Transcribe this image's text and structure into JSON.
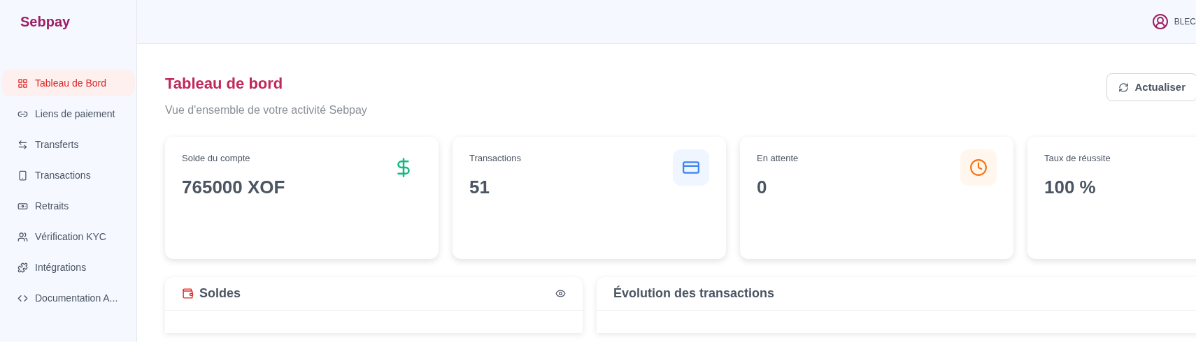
{
  "brand": "Sebpay",
  "sidebar": {
    "items": [
      {
        "label": "Tableau de Bord",
        "selected": true
      },
      {
        "label": "Liens de paiement",
        "selected": false
      },
      {
        "label": "Transferts",
        "selected": false
      },
      {
        "label": "Transactions",
        "selected": false
      },
      {
        "label": "Retraits",
        "selected": false
      },
      {
        "label": "Vérification KYC",
        "selected": false
      },
      {
        "label": "Intégrations",
        "selected": false
      },
      {
        "label": "Documentation A...",
        "selected": false
      }
    ]
  },
  "header": {
    "user": "BLEC"
  },
  "page": {
    "title": "Tableau de bord",
    "subtitle": "Vue d'ensemble de votre activité Sebpay",
    "refresh_button": "Actualiser"
  },
  "stats": [
    {
      "label": "Solde du compte",
      "value": "765000 XOF"
    },
    {
      "label": "Transactions",
      "value": "51"
    },
    {
      "label": "En attente",
      "value": "0"
    },
    {
      "label": "Taux de réussite",
      "value": "100 %"
    }
  ],
  "panels": [
    {
      "title": "Soldes",
      "kind": "balances"
    },
    {
      "title": "Évolution des transactions",
      "kind": "chart"
    }
  ]
}
